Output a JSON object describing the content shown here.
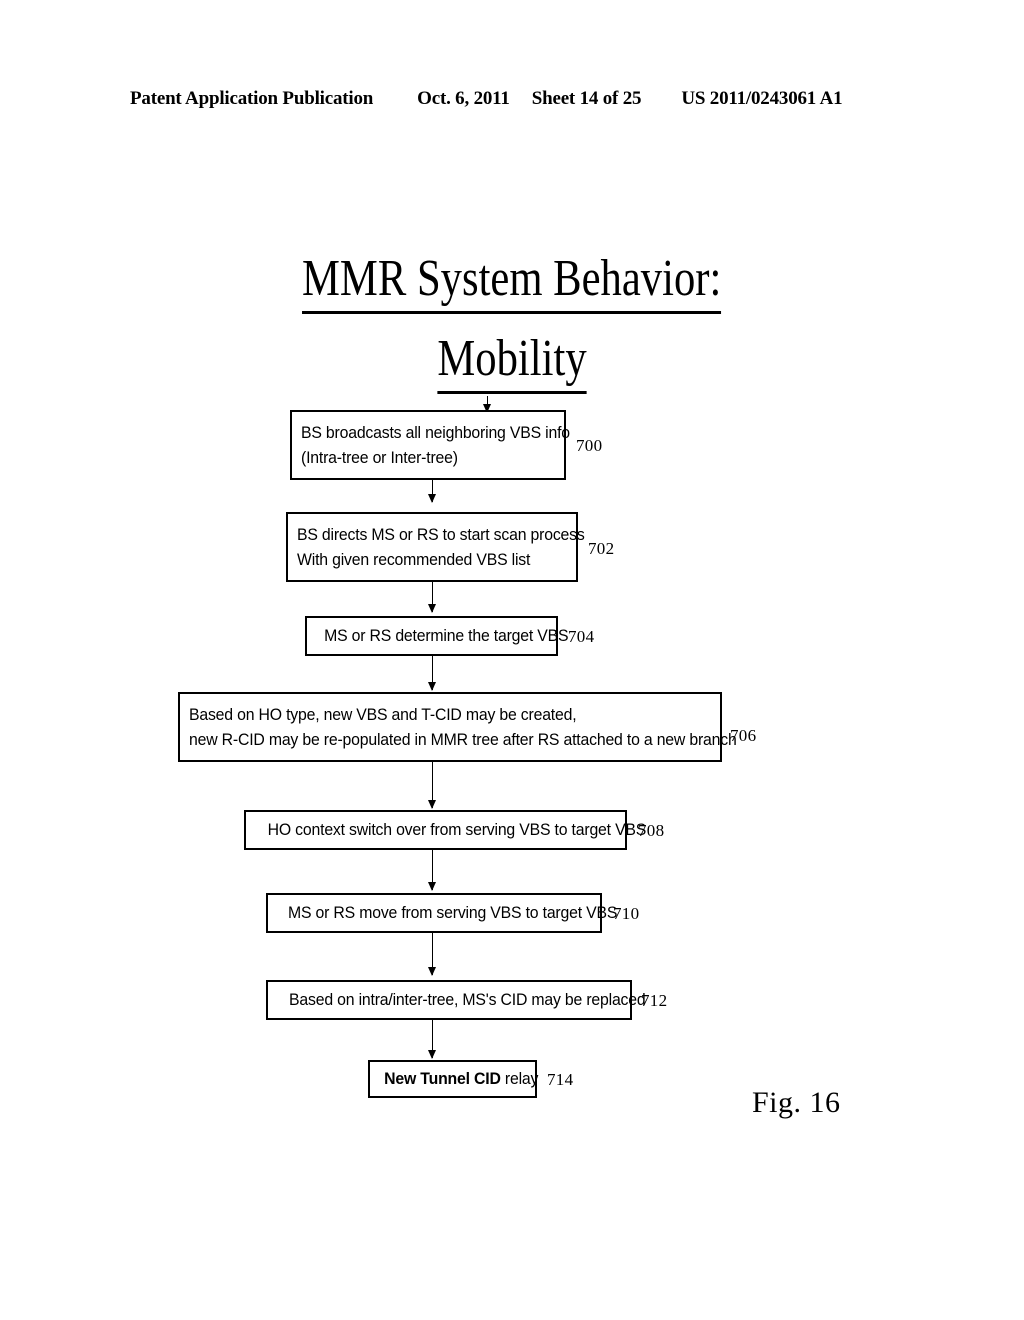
{
  "header": {
    "publication": "Patent Application Publication",
    "date": "Oct. 6, 2011",
    "sheet": "Sheet 14 of 25",
    "patent_number": "US 2011/0243061 A1"
  },
  "figure": {
    "title_line1": "MMR System Behavior:",
    "title_line2": "Mobility",
    "caption": "Fig. 16"
  },
  "flow": {
    "steps": [
      {
        "ref": "700",
        "lines": [
          "BS broadcasts all neighboring VBS info",
          "(Intra-tree or Inter-tree)"
        ]
      },
      {
        "ref": "702",
        "lines": [
          "BS directs MS or RS to start scan process",
          "With given recommended VBS list"
        ]
      },
      {
        "ref": "704",
        "lines": [
          "MS or RS determine the target VBS"
        ]
      },
      {
        "ref": "706",
        "lines": [
          "Based on HO type, new VBS and T-CID may be created,",
          "new R-CID may be re-populated in MMR tree after RS attached to a new branch"
        ]
      },
      {
        "ref": "708",
        "lines": [
          "HO context switch over from serving VBS to target VBS"
        ]
      },
      {
        "ref": "710",
        "lines": [
          "MS or RS move from serving VBS to target VBS"
        ]
      },
      {
        "ref": "712",
        "lines": [
          "Based on intra/inter-tree, MS's CID may be replaced"
        ]
      },
      {
        "ref": "714",
        "bold_prefix": "New Tunnel CID",
        "lines": [
          " relay"
        ]
      }
    ]
  }
}
